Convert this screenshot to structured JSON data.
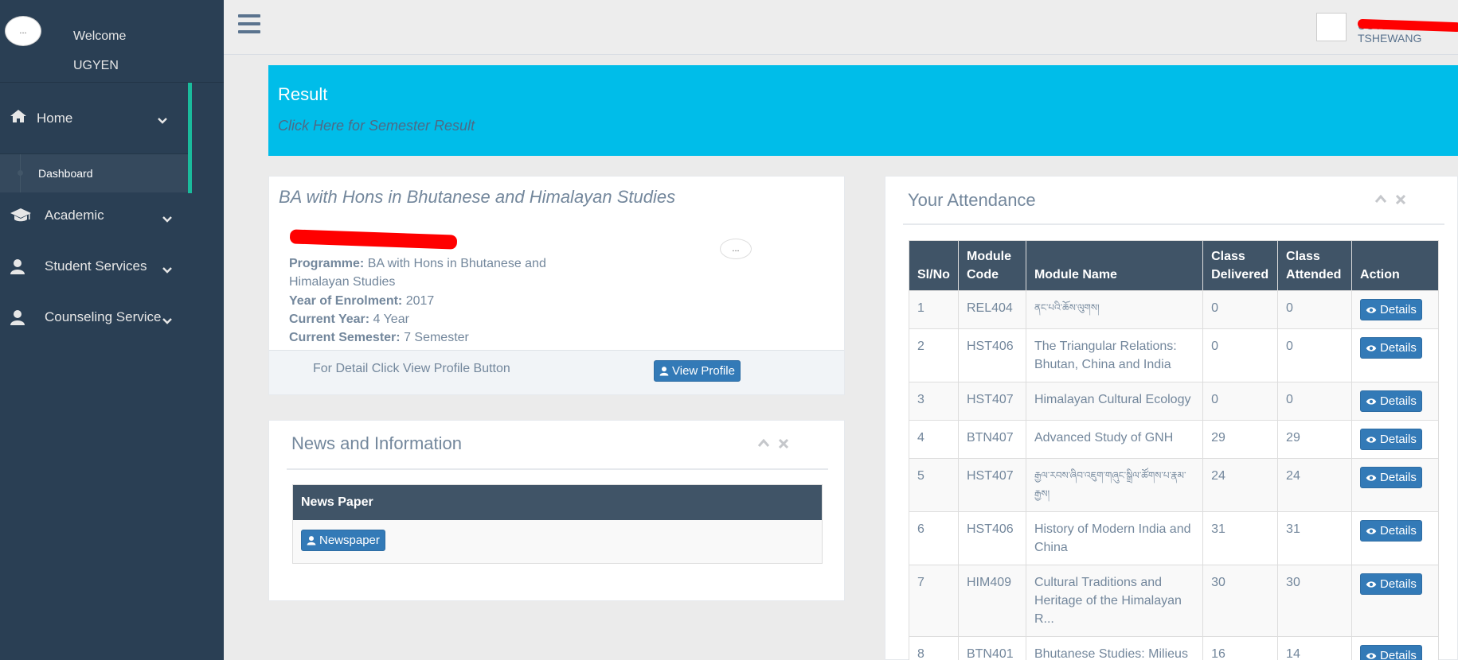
{
  "sidebar": {
    "avatar_alt": "...",
    "welcome": "Welcome",
    "username": "UGYEN",
    "items": [
      {
        "label": "Home"
      },
      {
        "label": "Dashboard"
      },
      {
        "label": "Academic"
      },
      {
        "label": "Student Services"
      },
      {
        "label": "Counseling Service"
      }
    ]
  },
  "topbar": {
    "user_name": "UGYEN TSHEWANG"
  },
  "result": {
    "title": "Result",
    "link": "Click Here for Semester Result"
  },
  "programme": {
    "title": "BA with Hons in Bhutanese and Himalayan Studies",
    "avatar_alt": "...",
    "programme_label": "Programme:",
    "programme_value": "BA with Hons in Bhutanese and Himalayan Studies",
    "year_label": "Year of Enrolment:",
    "year_value": "2017",
    "current_year_label": "Current Year:",
    "current_year_value": "4 Year",
    "semester_label": "Current Semester:",
    "semester_value": "7 Semester",
    "footer_text": "For Detail Click View Profile Button",
    "view_profile": "View Profile"
  },
  "news": {
    "title": "News and Information",
    "column": "News Paper",
    "button": "Newspaper"
  },
  "attendance": {
    "title": "Your Attendance",
    "headers": [
      "Sl/No",
      "Module Code",
      "Module Name",
      "Class Delivered",
      "Class Attended",
      "Action"
    ],
    "action_label": "Details",
    "rows": [
      {
        "no": "1",
        "code": "REL404",
        "name": "ནང་པའི་ཆོས་ལུགས།",
        "delivered": "0",
        "attended": "0"
      },
      {
        "no": "2",
        "code": "HST406",
        "name": "The Triangular Relations: Bhutan, China and India",
        "delivered": "0",
        "attended": "0"
      },
      {
        "no": "3",
        "code": "HST407",
        "name": "Himalayan Cultural Ecology",
        "delivered": "0",
        "attended": "0"
      },
      {
        "no": "4",
        "code": "BTN407",
        "name": "Advanced Study of GNH",
        "delivered": "29",
        "attended": "29"
      },
      {
        "no": "5",
        "code": "HST407",
        "name": "རྒྱལ་རབས་ཞིབ་འཇུག་གཞུང་སྒྲིལ་ཚོགས་པ་རྣམ་རྒྱས།",
        "delivered": "24",
        "attended": "24"
      },
      {
        "no": "6",
        "code": "HST406",
        "name": "History of Modern India and China",
        "delivered": "31",
        "attended": "31"
      },
      {
        "no": "7",
        "code": "HIM409",
        "name": "Cultural Traditions and Heritage of the Himalayan R...",
        "delivered": "30",
        "attended": "30"
      },
      {
        "no": "8",
        "code": "BTN401",
        "name": "Bhutanese Studies: Milieus",
        "delivered": "16",
        "attended": "14"
      }
    ]
  }
}
